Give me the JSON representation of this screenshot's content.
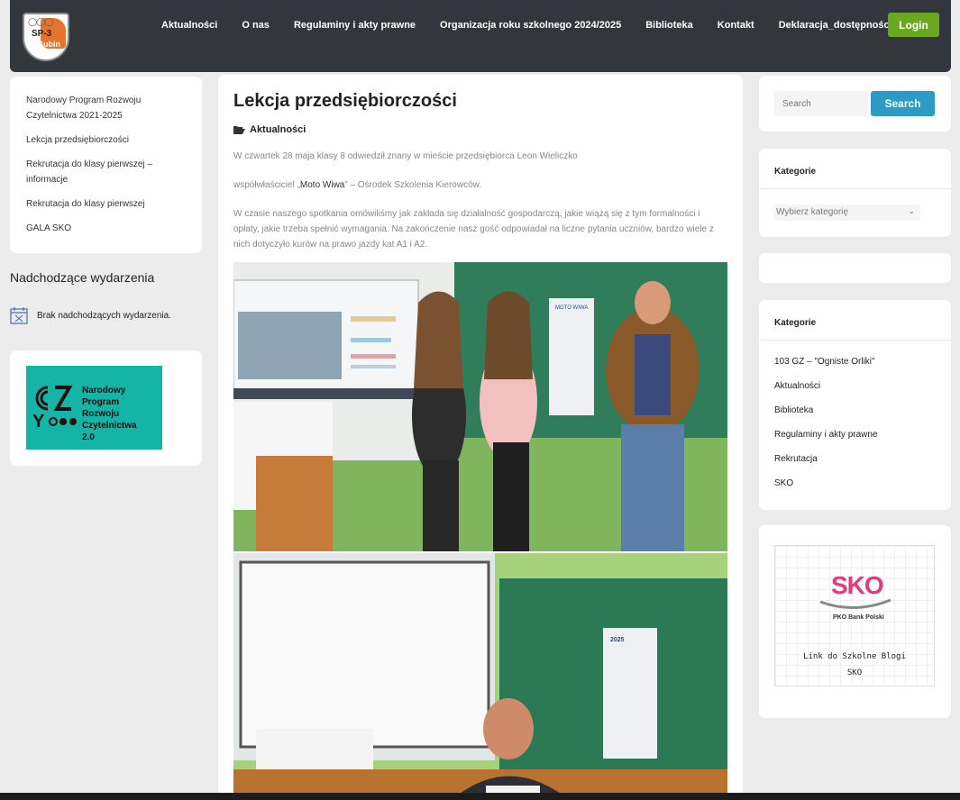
{
  "header": {
    "logo_top": "SP-3",
    "logo_bottom": "Gubin",
    "nav": [
      "Aktualności",
      "O nas",
      "Regulaminy i akty prawne",
      "Organizacja roku szkolnego 2024/2025",
      "Biblioteka",
      "Kontakt",
      "Deklaracja_dostępności"
    ],
    "login_label": "Login"
  },
  "left": {
    "links": [
      "Narodowy Program Rozwoju Czytelnictwa 2021-2025",
      "Lekcja przedsiębiorczości",
      "Rekrutacja do klasy pierwszej – informacje",
      "Rekrutacja do klasy pierwszej",
      "GALA SKO"
    ],
    "events_title": "Nadchodzące wydarzenia",
    "events_empty": "Brak nadchodzących wydarzenia.",
    "banner_text": [
      "Narodowy",
      "Program",
      "Rozwoju",
      "Czytelnictwa",
      "2.0"
    ]
  },
  "article": {
    "title": "Lekcja przedsiębiorczości",
    "category": "Aktualności",
    "p1": "W czwartek 28 maja klasy 8 odwiedził znany w mieście przedsiębiorca Leon Wieliczko",
    "p2_pre": "współwłaściciel „",
    "p2_bold": "Moto Wiwa",
    "p2_post": "” – Ośrodek Szkolenia Kierowców.",
    "p3": "W czasie naszego spotkania omówiliśmy jak zakłada się działalność gospodarczą, jakie wiążą się z tym formalności i opłaty, jakie trzeba spełnić wymagania. Na zakończenie nasz gość odpowiadał na liczne pytania uczniów, bardzo wiele z nich dotyczyło kurów na prawo jazdy kat A1 i A2.",
    "calendar_text": "MOTO WIWA",
    "calendar_year": "2025"
  },
  "right": {
    "search_placeholder": "Search",
    "search_button": "Search",
    "categories_title": "Kategorie",
    "select_placeholder": "Wybierz kategorię",
    "categories2_title": "Kategorie",
    "categories": [
      "103 GZ – \"Ogniste Orliki\"",
      "Aktualności",
      "Biblioteka",
      "Regulaminy i akty prawne",
      "Rekrutacja",
      "SKO"
    ],
    "sko_logo": "SKO",
    "sko_bank": "PKO Bank Polski",
    "sko_link_line1": "Link do Szkolne Blogi",
    "sko_link_line2": "SKO"
  },
  "colors": {
    "header_bg": "#33363c",
    "login_green": "#6aa81d",
    "search_blue": "#2c9bc6",
    "nprc_teal": "#14b5a7"
  }
}
